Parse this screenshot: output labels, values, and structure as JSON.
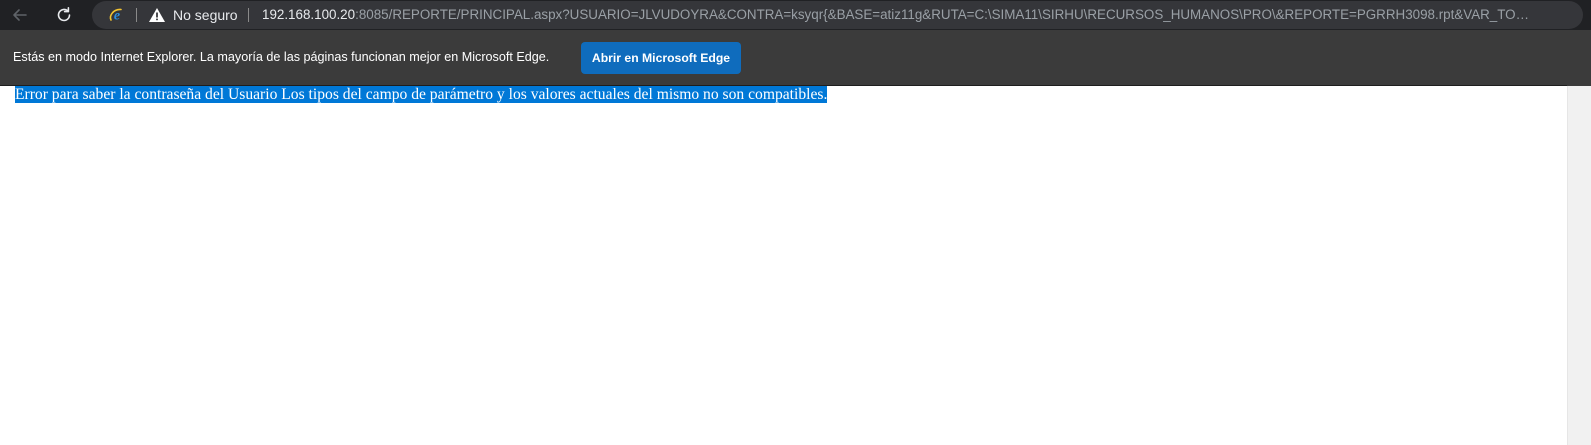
{
  "toolbar": {
    "back_icon": "arrow-left-icon",
    "refresh_icon": "refresh-icon"
  },
  "address_bar": {
    "browser_mode_icon": "internet-explorer-icon",
    "security_icon": "warning-triangle-icon",
    "security_label": "No seguro",
    "url_host": "192.168.100.20",
    "url_rest": ":8085/REPORTE/PRINCIPAL.aspx?USUARIO=JLVUDOYRA&CONTRA=ksyqr{&BASE=atiz11g&RUTA=C:\\SIMA11\\SIRHU\\RECURSOS_HUMANOS\\PRO\\&REPORTE=PGRRH3098.rpt&VAR_TOTAL_PAR..."
  },
  "ie_mode_bar": {
    "message": "Estás en modo Internet Explorer. La mayoría de las páginas funcionan mejor en Microsoft Edge.",
    "button_label": "Abrir en Microsoft Edge",
    "button_color": "#0f6cbd",
    "bar_color": "#3b3b3b"
  },
  "page": {
    "error_message": "Error para saber la contraseña del Usuario Los tipos del campo de parámetro y los valores actuales del mismo no son compatibles.",
    "selection_color": "#0078d7"
  }
}
